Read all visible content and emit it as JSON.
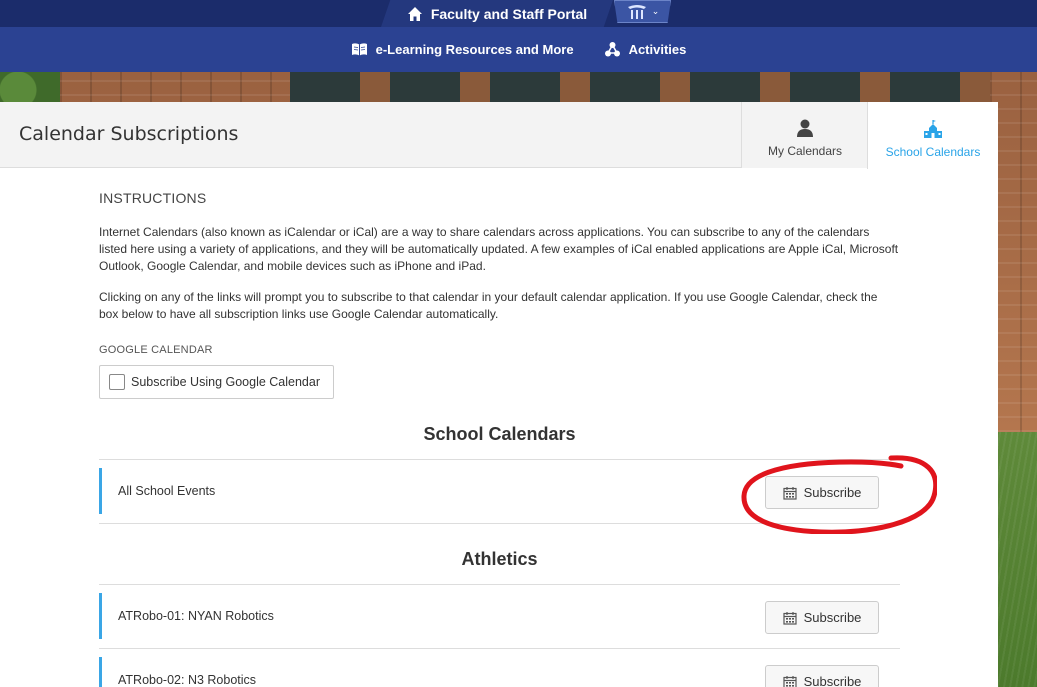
{
  "header": {
    "portal_title": "Faculty and Staff Portal",
    "home_icon": "home-icon",
    "logo_icon": "school-logo-icon",
    "nav": [
      {
        "label": "e-Learning Resources and More",
        "icon": "book-icon"
      },
      {
        "label": "Activities",
        "icon": "molecule-icon"
      }
    ]
  },
  "page": {
    "title": "Calendar Subscriptions",
    "tabs": [
      {
        "label": "My Calendars",
        "icon": "person-icon",
        "active": false
      },
      {
        "label": "School Calendars",
        "icon": "school-building-icon",
        "active": true
      }
    ]
  },
  "instructions": {
    "heading": "INSTRUCTIONS",
    "paragraph1": "Internet Calendars (also known as iCalendar or iCal) are a way to share calendars across applications. You can subscribe to any of the calendars listed here using a variety of applications, and they will be automatically updated. A few examples of iCal enabled applications are Apple iCal, Microsoft Outlook, Google Calendar, and mobile devices such as iPhone and iPad.",
    "paragraph2": "Clicking on any of the links will prompt you to subscribe to that calendar in your default calendar application. If you use Google Calendar, check the box below to have all subscription links use Google Calendar automatically.",
    "google_label": "GOOGLE CALENDAR",
    "google_checkbox_label": "Subscribe Using Google Calendar",
    "google_checked": false
  },
  "sections": [
    {
      "title": "School Calendars",
      "items": [
        {
          "name": "All School Events",
          "button": "Subscribe"
        }
      ]
    },
    {
      "title": "Athletics",
      "items": [
        {
          "name": "ATRobo-01: NYAN Robotics",
          "button": "Subscribe"
        },
        {
          "name": "ATRobo-02: N3 Robotics",
          "button": "Subscribe"
        }
      ]
    }
  ],
  "colors": {
    "topbar": "#1b2c6b",
    "navbar": "#2b4292",
    "accent": "#2aa4e8",
    "annotation": "#e0141c"
  }
}
